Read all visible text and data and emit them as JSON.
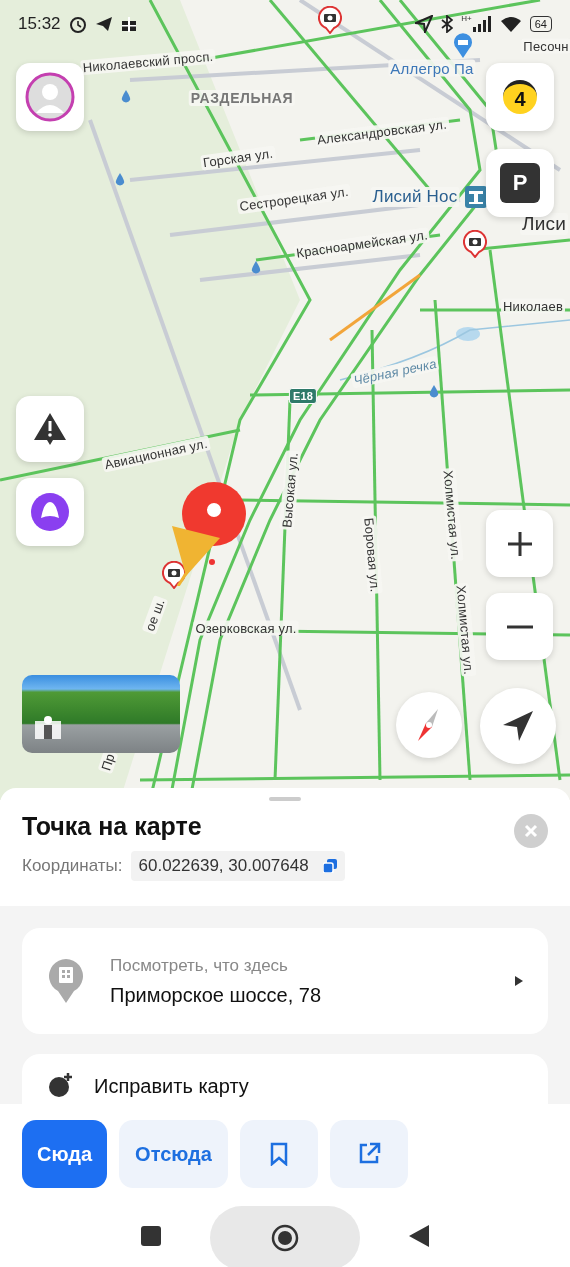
{
  "status_bar": {
    "time": "15:32",
    "network": "H+",
    "battery": "64"
  },
  "map": {
    "labels": [
      {
        "text": "Николаевский просп.",
        "kind": "street"
      },
      {
        "text": "РАЗДЕЛЬНАЯ",
        "kind": "district"
      },
      {
        "text": "Горская ул.",
        "kind": "street"
      },
      {
        "text": "Александровская ул.",
        "kind": "street"
      },
      {
        "text": "Сестрорецкая ул.",
        "kind": "street"
      },
      {
        "text": "Красноармейская ул.",
        "kind": "street"
      },
      {
        "text": "Лисий Нос",
        "kind": "station"
      },
      {
        "text": "Лиси",
        "kind": "town"
      },
      {
        "text": "Аллегро Па",
        "kind": "poi"
      },
      {
        "text": "Песочн",
        "kind": "street"
      },
      {
        "text": "Николаев",
        "kind": "street"
      },
      {
        "text": "Чёрная речка",
        "kind": "river"
      },
      {
        "text": "E18",
        "kind": "road_number"
      },
      {
        "text": "Авиационная ул.",
        "kind": "street"
      },
      {
        "text": "Высокая ул.",
        "kind": "street"
      },
      {
        "text": "Боровая ул.",
        "kind": "street"
      },
      {
        "text": "Холмистая ул.",
        "kind": "street"
      },
      {
        "text": "Холмистая ул.",
        "kind": "street"
      },
      {
        "text": "Озерковская ул.",
        "kind": "street"
      },
      {
        "text": "ое ш.",
        "kind": "street"
      },
      {
        "text": "Пр",
        "kind": "street"
      }
    ],
    "traffic_score": "4",
    "parking": "P"
  },
  "place": {
    "title": "Точка на карте",
    "coords_label": "Координаты:",
    "coords": "60.022639, 30.007648",
    "card": {
      "hint": "Посмотреть, что здесь",
      "address": "Приморское шоссе, 78"
    },
    "fix_map": "Исправить карту",
    "actions": [
      {
        "kind": "text",
        "label": "Сюда",
        "primary": true
      },
      {
        "kind": "text",
        "label": "Отсюда",
        "primary": false
      },
      {
        "kind": "bookmark",
        "primary": false
      },
      {
        "kind": "share",
        "primary": false
      }
    ]
  }
}
